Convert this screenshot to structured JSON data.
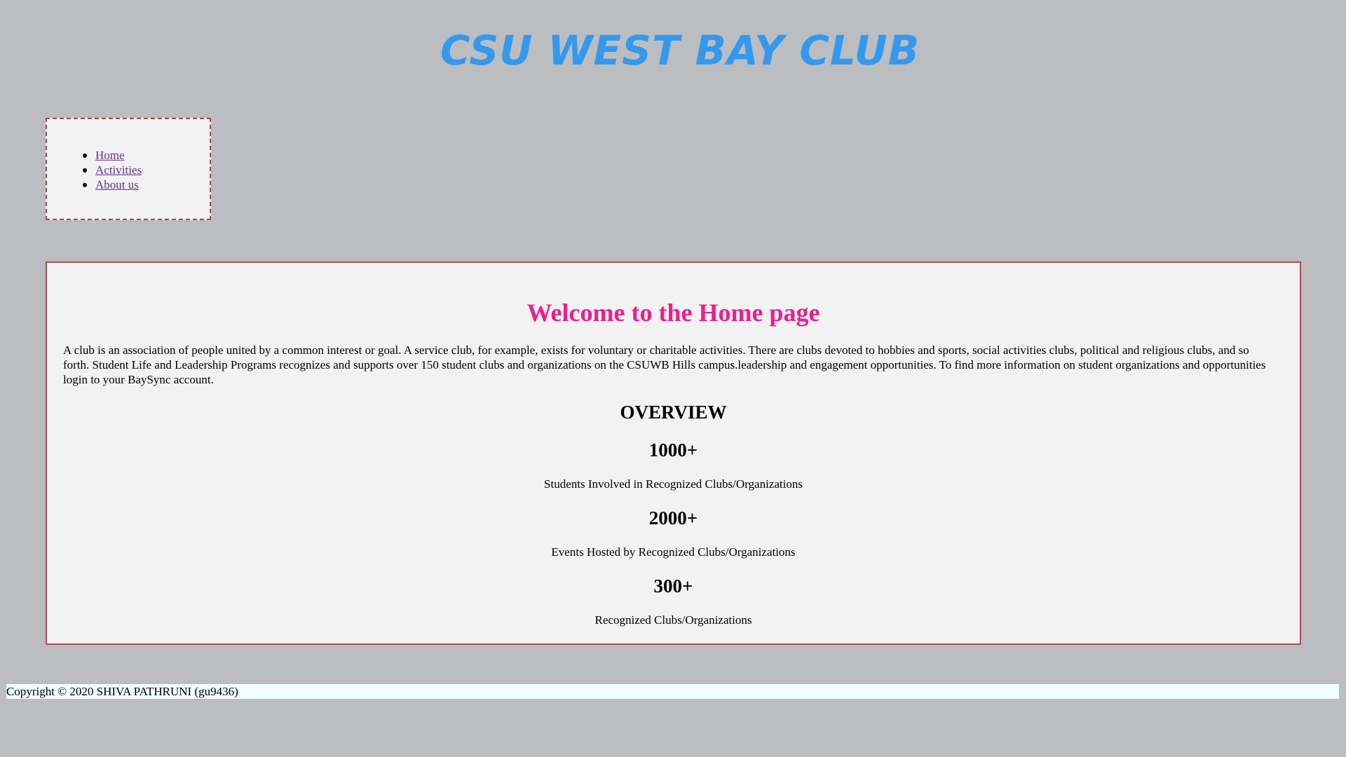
{
  "header": {
    "title": "CSU WEST BAY CLUB"
  },
  "nav": {
    "items": [
      {
        "label": "Home"
      },
      {
        "label": "Activities"
      },
      {
        "label": "About us"
      }
    ]
  },
  "main": {
    "heading": "Welcome to the Home page",
    "intro": "A club is an association of people united by a common interest or goal. A service club, for example, exists for voluntary or charitable activities. There are clubs devoted to hobbies and sports, social activities clubs, political and religious clubs, and so forth. Student Life and Leadership Programs recognizes and supports over 150 student clubs and organizations on the CSUWB Hills campus.leadership and engagement opportunities. To find more information on student organizations and opportunities login to your BaySync account.",
    "overview_heading": "OVERVIEW",
    "stats": [
      {
        "number": "1000+",
        "label": "Students Involved in Recognized Clubs/Organizations"
      },
      {
        "number": "2000+",
        "label": "Events Hosted by Recognized Clubs/Organizations"
      },
      {
        "number": "300+",
        "label": "Recognized Clubs/Organizations"
      }
    ]
  },
  "footer": {
    "text": "Copyright © 2020 SHIVA PATHRUNI (gu9436)"
  },
  "colors": {
    "background": "#bbbdc1",
    "title": "#3399ee",
    "heading": "#ee1e8c",
    "link": "#6a2f9a",
    "panel": "#f2f2f2",
    "footer": "#f0fffe"
  }
}
